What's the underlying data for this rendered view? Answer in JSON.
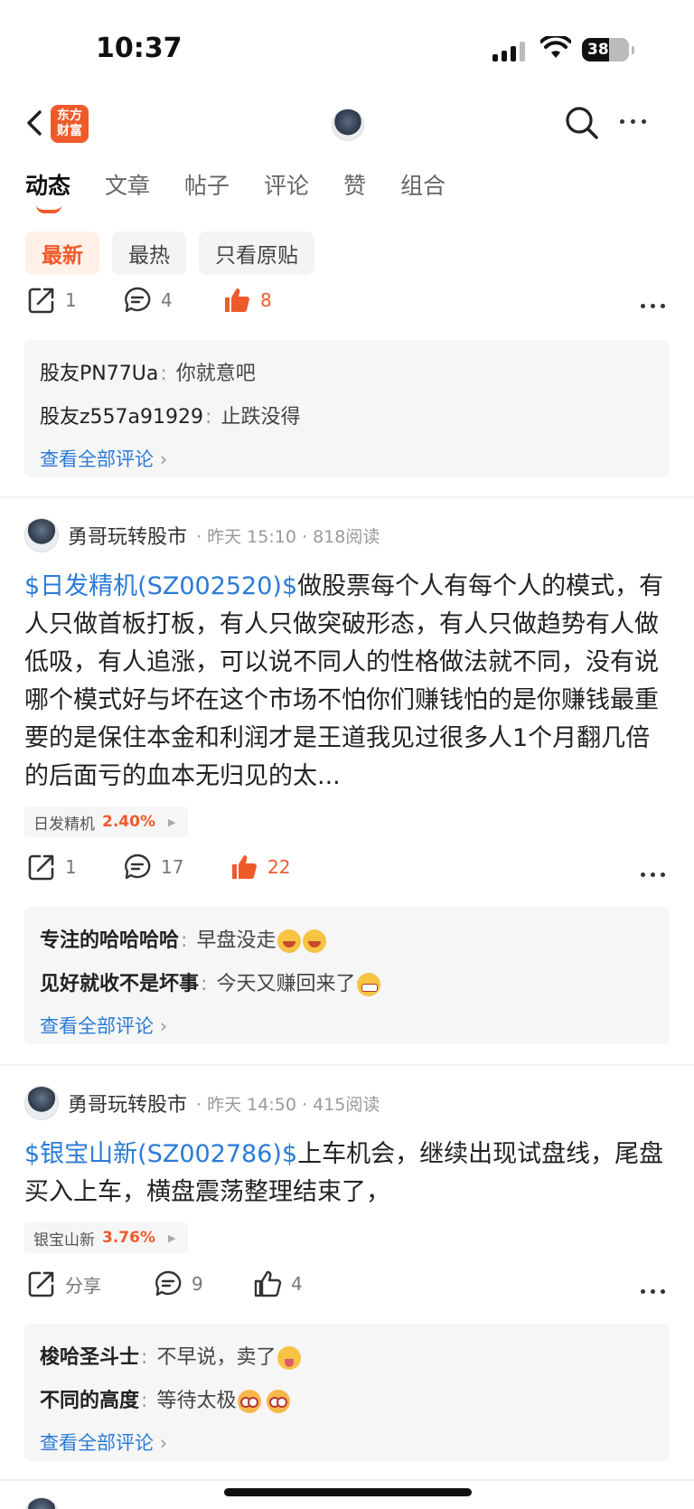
{
  "status": {
    "time": "10:37",
    "battery": "38"
  },
  "header": {
    "logo_line1": "东方",
    "logo_line2": "财富"
  },
  "tabs": [
    {
      "label": "动态"
    },
    {
      "label": "文章"
    },
    {
      "label": "帖子"
    },
    {
      "label": "评论"
    },
    {
      "label": "赞"
    },
    {
      "label": "组合"
    }
  ],
  "filters": [
    {
      "label": "最新"
    },
    {
      "label": "最热"
    },
    {
      "label": "只看原贴"
    }
  ],
  "post0": {
    "share": "1",
    "comments": "4",
    "likes": "8",
    "comment_list": [
      {
        "user": "股友PN77Ua",
        "text": "你就意吧"
      },
      {
        "user": "股友z557a91929",
        "text": "止跌没得"
      }
    ],
    "view_all": "查看全部评论"
  },
  "post1": {
    "author": "勇哥玩转股市",
    "time": "昨天 15:10",
    "reads": "818阅读",
    "stock": "$日发精机(SZ002520)$",
    "text": "做股票每个人有每个人的模式，有人只做首板打板，有人只做突破形态，有人只做趋势有人做低吸，有人追涨，可以说不同人的性格做法就不同，没有说哪个模式好与坏在这个市场不怕你们赚钱怕的是你赚钱最重要的是保住本金和利润才是王道我见过很多人1个月翻几倍的后面亏的血本无归见的太...",
    "tag_name": "日发精机",
    "tag_pct": "2.40%",
    "share": "1",
    "comments": "17",
    "likes": "22",
    "comment_list": [
      {
        "user": "专注的哈哈哈哈",
        "text": "早盘没走"
      },
      {
        "user": "见好就收不是坏事",
        "text": "今天又赚回来了"
      }
    ],
    "view_all": "查看全部评论"
  },
  "post2": {
    "author": "勇哥玩转股市",
    "time": "昨天 14:50",
    "reads": "415阅读",
    "stock": "$银宝山新(SZ002786)$",
    "text": "上车机会，继续出现试盘线，尾盘买入上车，横盘震荡整理结束了，",
    "tag_name": "银宝山新",
    "tag_pct": "3.76%",
    "share": "分享",
    "comments": "9",
    "likes": "4",
    "comment_list": [
      {
        "user": "梭哈圣斗士",
        "text": "不早说，卖了"
      },
      {
        "user": "不同的高度",
        "text": "等待太极"
      }
    ],
    "view_all": "查看全部评论"
  },
  "colors": {
    "accent": "#ef5a2a",
    "link": "#2a7bd6"
  }
}
